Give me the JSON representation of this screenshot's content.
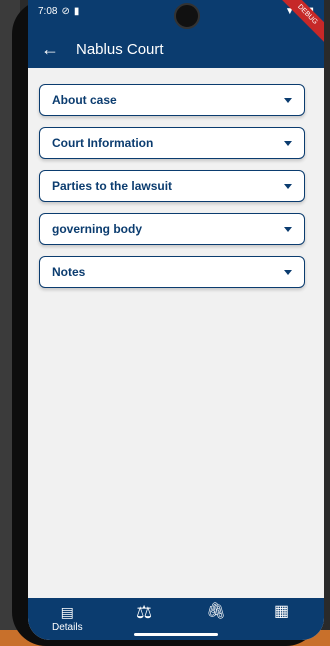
{
  "status": {
    "time": "7:08",
    "ribbon": "DEBUG"
  },
  "appbar": {
    "title": "Nablus Court",
    "back_icon": "arrow-left-icon"
  },
  "sections": [
    {
      "label": "About case"
    },
    {
      "label": "Court Information"
    },
    {
      "label": "Parties to the lawsuit"
    },
    {
      "label": "governing  body"
    },
    {
      "label": "Notes"
    }
  ],
  "bottom_nav": {
    "items": [
      {
        "label": "Details",
        "icon": "list-icon"
      },
      {
        "label": "",
        "icon": "gavel-icon"
      },
      {
        "label": "",
        "icon": "paperclip-icon"
      },
      {
        "label": "",
        "icon": "calendar-icon"
      }
    ]
  }
}
